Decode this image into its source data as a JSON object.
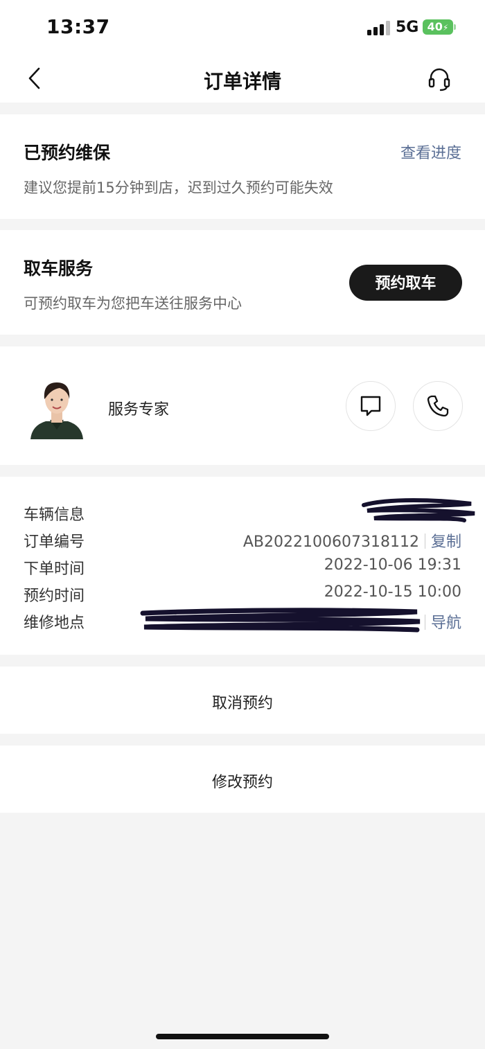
{
  "status_bar": {
    "time": "13:37",
    "network": "5G",
    "battery": "40"
  },
  "nav": {
    "title": "订单详情"
  },
  "booking_status": {
    "title": "已预约维保",
    "subtitle": "建议您提前15分钟到店，迟到过久预约可能失效",
    "link": "查看进度"
  },
  "pickup": {
    "title": "取车服务",
    "subtitle": "可预约取车为您把车送往服务中心",
    "button": "预约取车"
  },
  "expert": {
    "label": "服务专家"
  },
  "info": {
    "rows": [
      {
        "label": "车辆信息"
      },
      {
        "label": "订单编号",
        "value": "AB2022100607318112",
        "action": "复制"
      },
      {
        "label": "下单时间",
        "value": "2022-10-06 19:31"
      },
      {
        "label": "预约时间",
        "value": "2022-10-15 10:00"
      },
      {
        "label": "维修地点",
        "action": "导航"
      }
    ]
  },
  "actions": {
    "cancel": "取消预约",
    "modify": "修改预约"
  },
  "colors": {
    "link": "#5b6f95",
    "battery": "#5ac15e",
    "button": "#1a1a1a"
  }
}
